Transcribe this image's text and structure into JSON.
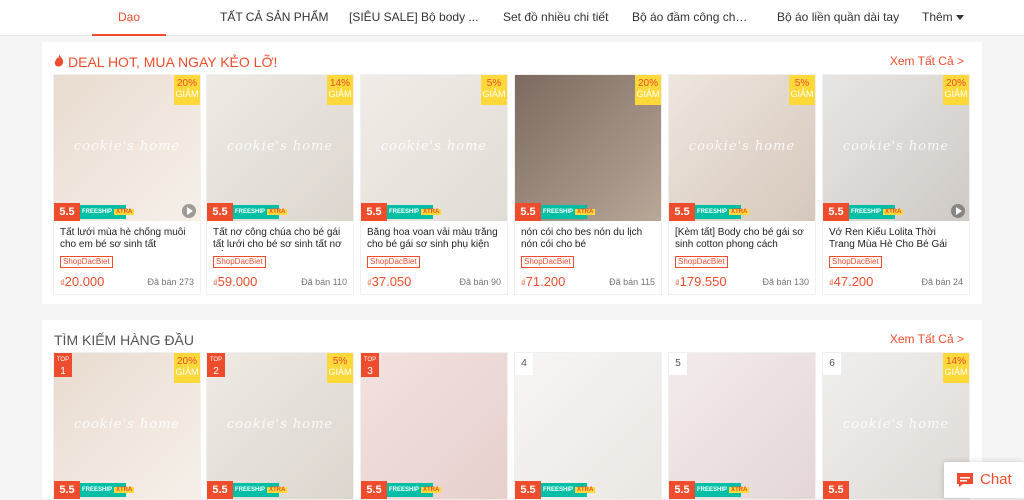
{
  "nav": {
    "tabs": [
      "Dạo",
      "TẤT CẢ SẢN PHẨM",
      "[SIÊU SALE] Bộ body ...",
      "Set đồ nhiều chi tiết",
      "Bộ áo đầm công chúa...",
      "Bộ áo liền quần dài tay"
    ],
    "more": "Thêm"
  },
  "deal_section": {
    "title": "DEAL HOT, MUA NGAY KẺO LỠ!",
    "see_all": "Xem Tất Cả >",
    "products": [
      {
        "name": "Tất lưới mùa hè chống muỗi cho em bé sơ sinh tất chống...",
        "shop_tag": "ShopDacBiet",
        "currency": "₫",
        "price": "20.000",
        "sold": "Đã bán 273",
        "discount": "20%",
        "discount_label": "GIẢM",
        "promo": "5.5",
        "freeship": "FREESHIP",
        "xtra": "XTRA",
        "watermark": "cookie's home"
      },
      {
        "name": "Tất nơ công chúa cho bé gái tất lưới cho bé sơ sinh tất nơ trắng",
        "shop_tag": "ShopDacBiet",
        "currency": "₫",
        "price": "59.000",
        "sold": "Đã bán 110",
        "discount": "14%",
        "discount_label": "GIẢM",
        "promo": "5.5",
        "freeship": "FREESHIP",
        "xtra": "XTRA",
        "watermark": "cookie's home"
      },
      {
        "name": "Băng hoa voan vải màu trắng cho bé gái sơ sinh phụ kiện t...",
        "shop_tag": "ShopDacBiet",
        "currency": "₫",
        "price": "37.050",
        "sold": "Đã bán 90",
        "discount": "5%",
        "discount_label": "GIẢM",
        "promo": "5.5",
        "freeship": "FREESHIP",
        "xtra": "XTRA",
        "watermark": "cookie's home"
      },
      {
        "name": "nón cói cho bes nón du lịch nón cói cho bé",
        "shop_tag": "ShopDacBiet",
        "currency": "₫",
        "price": "71.200",
        "sold": "Đã bán 115",
        "discount": "20%",
        "discount_label": "GIẢM",
        "promo": "5.5",
        "freeship": "FREESHIP",
        "xtra": "XTRA",
        "watermark": ""
      },
      {
        "name": "[Kèm tất] Body cho bé gái sơ sinh cotton phong cách Korea...",
        "shop_tag": "ShopDacBiet",
        "currency": "₫",
        "price": "179.550",
        "sold": "Đã bán 130",
        "discount": "5%",
        "discount_label": "GIẢM",
        "promo": "5.5",
        "freeship": "FREESHIP",
        "xtra": "XTRA",
        "watermark": "cookie's home"
      },
      {
        "name": "Vớ Ren Kiểu Lolita Thời Trang Mùa Hè Cho Bé Gái",
        "shop_tag": "ShopDacBiet",
        "currency": "₫",
        "price": "47.200",
        "sold": "Đã bán 24",
        "discount": "20%",
        "discount_label": "GIẢM",
        "promo": "5.5",
        "freeship": "FREESHIP",
        "xtra": "XTRA",
        "watermark": "cookie's home"
      }
    ]
  },
  "top_section": {
    "title": "TÌM KIẾM HÀNG ĐẦU",
    "see_all": "Xem Tất Cả >",
    "top_label": "TOP",
    "products": [
      {
        "rank": "1",
        "discount": "20%",
        "discount_label": "GIẢM",
        "promo": "5.5",
        "freeship": "FREESHIP",
        "xtra": "XTRA",
        "watermark": "cookie's home"
      },
      {
        "rank": "2",
        "discount": "5%",
        "discount_label": "GIẢM",
        "promo": "5.5",
        "freeship": "FREESHIP",
        "xtra": "XTRA",
        "watermark": "cookie's home"
      },
      {
        "rank": "3",
        "discount": "",
        "discount_label": "",
        "promo": "5.5",
        "freeship": "FREESHIP",
        "xtra": "XTRA",
        "watermark": ""
      },
      {
        "rank": "4",
        "discount": "",
        "discount_label": "",
        "promo": "5.5",
        "freeship": "FREESHIP",
        "xtra": "XTRA",
        "watermark": ""
      },
      {
        "rank": "5",
        "discount": "",
        "discount_label": "",
        "promo": "5.5",
        "freeship": "FREESHIP",
        "xtra": "XTRA",
        "watermark": ""
      },
      {
        "rank": "6",
        "discount": "14%",
        "discount_label": "GIẢM",
        "promo": "5.5",
        "freeship": "",
        "xtra": "",
        "watermark": "cookie's home"
      }
    ]
  },
  "chat": {
    "label": "Chat",
    "icon": "chat-bubble-icon"
  },
  "colors": {
    "accent": "#ee4d2d",
    "discount_bg": "#ffd839",
    "freeship": "#00bfa5"
  }
}
